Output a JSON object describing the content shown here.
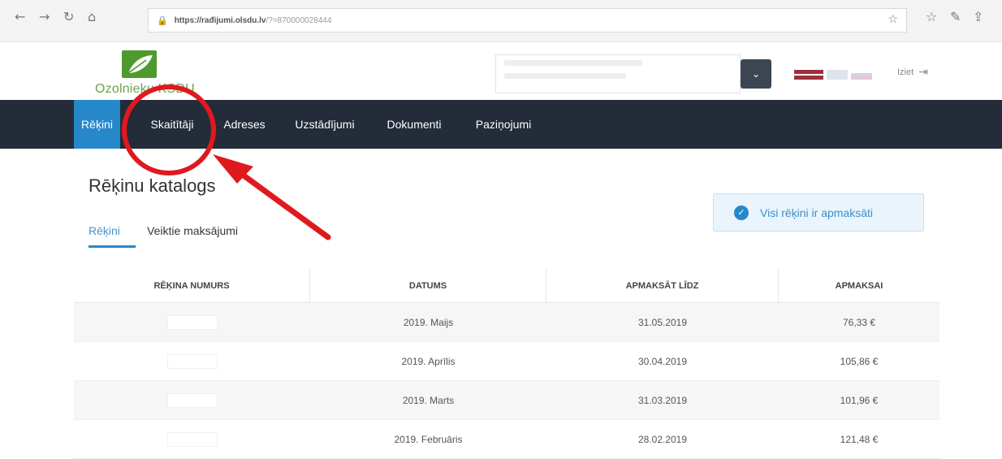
{
  "browser": {
    "url_host": "https://rađijumi.olsdu.lv",
    "url_rest": "/?=870000028444"
  },
  "header": {
    "logo_text": "Ozolnieku KSDU",
    "logout_label": "Iziet"
  },
  "nav": {
    "items": [
      {
        "label": "Rēķini",
        "active": true
      },
      {
        "label": "Skaitītāji",
        "active": false
      },
      {
        "label": "Adreses",
        "active": false
      },
      {
        "label": "Uzstādījumi",
        "active": false
      },
      {
        "label": "Dokumenti",
        "active": false
      },
      {
        "label": "Paziņojumi",
        "active": false
      }
    ]
  },
  "main": {
    "title": "Rēķinu katalogs",
    "tabs": [
      {
        "label": "Rēķini",
        "active": true
      },
      {
        "label": "Veiktie maksājumi",
        "active": false
      }
    ],
    "status": "Visi rēķini ir apmaksāti"
  },
  "table": {
    "headers": [
      "RĒĶINA NUMURS",
      "DATUMS",
      "APMAKSĀT LĪDZ",
      "APMAKSAI"
    ],
    "rows": [
      {
        "date": "2019. Maijs",
        "due": "31.05.2019",
        "amount": "76,33 €"
      },
      {
        "date": "2019. Aprīlis",
        "due": "30.04.2019",
        "amount": "105,86 €"
      },
      {
        "date": "2019. Marts",
        "due": "31.03.2019",
        "amount": "101,96 €"
      },
      {
        "date": "2019. Februāris",
        "due": "28.02.2019",
        "amount": "121,48 €"
      }
    ]
  },
  "colors": {
    "nav_bg": "#232c38",
    "nav_active": "#2688c9",
    "annotation": "#e0191f"
  }
}
